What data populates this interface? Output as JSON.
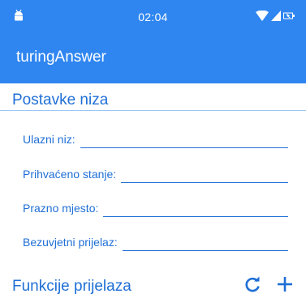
{
  "status_bar": {
    "time": "02:04",
    "icons": [
      "android-icon",
      "wifi-icon",
      "signal-icon",
      "battery-icon"
    ]
  },
  "app_bar": {
    "title": "turingAnswer"
  },
  "settings": {
    "title": "Postavke niza",
    "fields": [
      {
        "label": "Ulazni niz:",
        "value": ""
      },
      {
        "label": "Prihvaćeno stanje:",
        "value": ""
      },
      {
        "label": "Prazno mjesto:",
        "value": ""
      },
      {
        "label": "Bezuvjetni prijelaz:",
        "value": ""
      }
    ]
  },
  "functions": {
    "title": "Funkcije prijelaza",
    "actions": [
      "refresh-icon",
      "add-icon"
    ]
  },
  "colors": {
    "primary": "#2f86f0",
    "accent_text": "#1f6fd6",
    "divider": "#9cc6f3"
  }
}
